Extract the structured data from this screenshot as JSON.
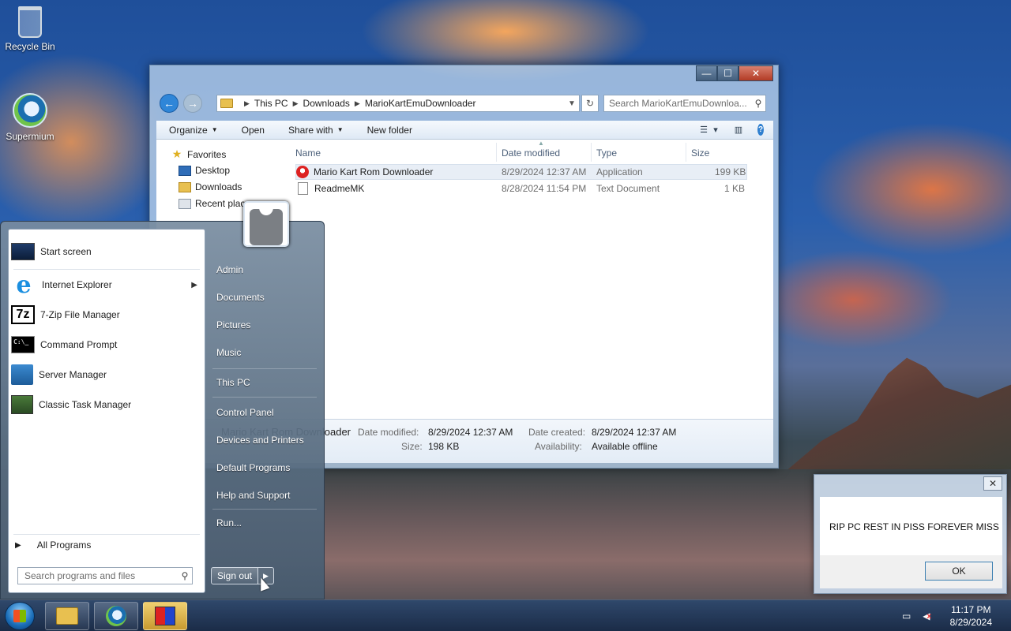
{
  "desktop": {
    "icons": [
      {
        "label": "Recycle Bin",
        "icon": "recycle-bin-icon"
      },
      {
        "label": "Supermium",
        "icon": "browser-icon"
      }
    ]
  },
  "explorer": {
    "window_buttons": {
      "minimize": "—",
      "maximize": "☐",
      "close": "✕"
    },
    "breadcrumb": [
      "This PC",
      "Downloads",
      "MarioKartEmuDownloader"
    ],
    "search_placeholder": "Search MarioKartEmuDownloa...",
    "toolbar": {
      "organize": "Organize",
      "open": "Open",
      "share_with": "Share with",
      "new_folder": "New folder"
    },
    "nav_pane": {
      "favorites": "Favorites",
      "desktop": "Desktop",
      "downloads": "Downloads",
      "recent_places": "Recent places"
    },
    "columns": {
      "name": "Name",
      "date_modified": "Date modified",
      "type": "Type",
      "size": "Size"
    },
    "files": [
      {
        "name": "Mario Kart Rom Downloader",
        "date": "8/29/2024 12:37 AM",
        "type": "Application",
        "size": "199 KB",
        "icon": "application-icon",
        "selected": true
      },
      {
        "name": "ReadmeMK",
        "date": "8/28/2024 11:54 PM",
        "type": "Text Document",
        "size": "1 KB",
        "icon": "text-document-icon",
        "selected": false
      }
    ],
    "details": {
      "name": "Mario Kart Rom Downloader",
      "date_modified_label": "Date modified:",
      "date_modified": "8/29/2024 12:37 AM",
      "date_created_label": "Date created:",
      "date_created": "8/29/2024 12:37 AM",
      "size_label": "Size:",
      "size": "198 KB",
      "availability_label": "Availability:",
      "availability": "Available offline"
    }
  },
  "start_menu": {
    "programs": [
      {
        "label": "Start screen",
        "icon": "start-screen-icon"
      },
      {
        "label": "Internet Explorer",
        "icon": "internet-explorer-icon",
        "has_submenu": true
      },
      {
        "label": "7-Zip File Manager",
        "icon": "seven-zip-icon"
      },
      {
        "label": "Command Prompt",
        "icon": "command-prompt-icon"
      },
      {
        "label": "Server Manager",
        "icon": "server-manager-icon"
      },
      {
        "label": "Classic Task Manager",
        "icon": "task-manager-icon"
      }
    ],
    "icon_text": {
      "seven_zip": "7z",
      "cmd": "C:\\_"
    },
    "all_programs": "All Programs",
    "search_placeholder": "Search programs and files",
    "right_items": [
      "Admin",
      "Documents",
      "Pictures",
      "Music",
      "This PC",
      "Control Panel",
      "Devices and Printers",
      "Default Programs",
      "Help and Support",
      "Run..."
    ],
    "sign_out": "Sign out"
  },
  "dialog": {
    "close": "✕",
    "message": "RIP PC REST IN PISS FOREVER MISS",
    "ok": "OK"
  },
  "taskbar": {
    "apps": [
      "file-explorer-icon",
      "browser-icon",
      "game-app-icon"
    ],
    "time": "11:17 PM",
    "date": "8/29/2024"
  }
}
